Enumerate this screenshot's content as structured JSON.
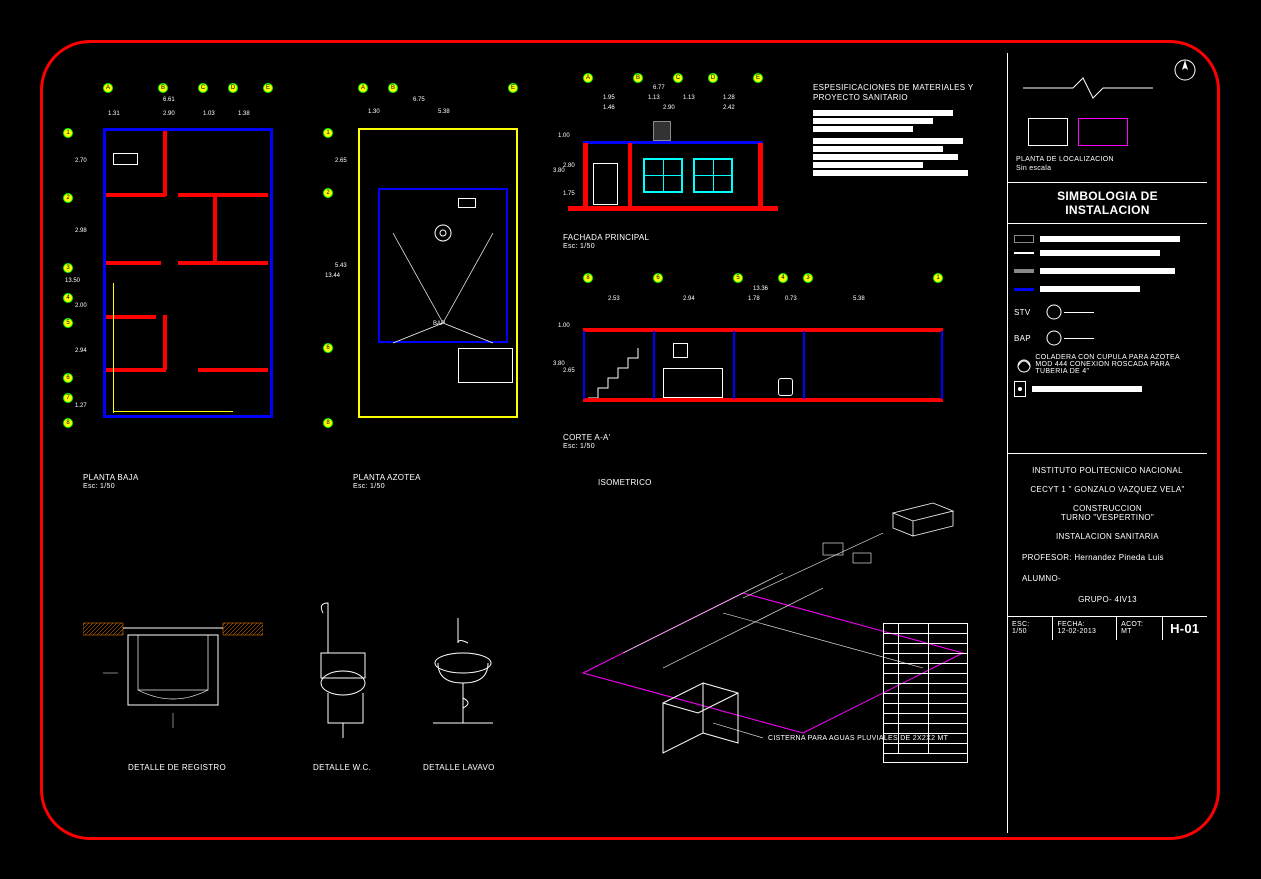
{
  "drawing": {
    "sheet_number": "H-01",
    "scale": "1/50",
    "date": "12-02-2013",
    "units": "MT",
    "scale_label": "ESC:",
    "date_label": "FECHA:",
    "units_label": "ACOT:"
  },
  "title_block": {
    "institution": "INSTITUTO POLITECNICO NACIONAL",
    "school": "CECYT 1 \" GONZALO VAZQUEZ VELA\"",
    "program": "CONSTRUCCION",
    "shift": "TURNO \"VESPERTINO\"",
    "subject": "INSTALACION SANITARIA",
    "professor_label": "PROFESOR:",
    "professor": "Hernandez Pineda Luis",
    "student_label": "ALUMNO-",
    "group_label": "GRUPO-",
    "group": "4IV13"
  },
  "legends": {
    "symbology_title": "SIMBOLOGIA DE INSTALACION",
    "location_plan": "PLANTA DE LOCALIZACION",
    "no_scale": "Sin escala",
    "stv": "STV",
    "bap": "BAP",
    "coladera": "COLADERA CON CUPULA PARA AZOTEA",
    "coladera2": "MOD 444 CONEXION ROSCADA PARA TUBERIA DE 4\"",
    "spec_title": "ESPESIFICACIONES DE MATERIALES Y PROYECTO SANITARIO"
  },
  "views": {
    "planta_baja": {
      "title": "PLANTA BAJA",
      "scale": "Esc: 1/50"
    },
    "planta_azotea": {
      "title": "PLANTA AZOTEA",
      "scale": "Esc: 1/50"
    },
    "fachada": {
      "title": "FACHADA PRINCIPAL",
      "scale": "Esc: 1/50"
    },
    "corte": {
      "title": "CORTE A-A'",
      "scale": "Esc: 1/50"
    },
    "iso": {
      "title": "ISOMETRICO"
    },
    "detalle_registro": {
      "title": "DETALLE DE REGISTRO"
    },
    "detalle_wc": {
      "title": "DETALLE W.C."
    },
    "detalle_lavabo": {
      "title": "DETALLE LAVAVO"
    },
    "cisterna": "CISTERNA PARA AGUAS PLUVIALES DE 2X2X2 MT",
    "bap_label": "BAP"
  },
  "dimensions": {
    "planta_baja": {
      "top_total": "6.61",
      "top": [
        "1.31",
        "2.90",
        "1.03",
        "1.38"
      ],
      "left_total": "13.50",
      "left": [
        "2.70",
        "2.98",
        "2.00",
        "2.94",
        "1.27"
      ],
      "grid_top": [
        "A",
        "B",
        "C",
        "D",
        "E"
      ],
      "grid_left": [
        "1",
        "2",
        "3",
        "4",
        "5",
        "6",
        "7",
        "8"
      ]
    },
    "planta_azotea": {
      "top_total": "6.75",
      "top": [
        "1.30",
        "5.38"
      ],
      "left_total": "13.44",
      "left": [
        "2.65",
        "5.43"
      ],
      "grid_top": [
        "A",
        "B",
        "E"
      ],
      "grid_left": [
        "1",
        "2",
        "6",
        "8"
      ]
    },
    "fachada": {
      "top_total": "6.77",
      "top": [
        "1.95",
        "1.13",
        "1.13",
        "1.28"
      ],
      "top2": [
        "1.46",
        "2.90",
        "2.42"
      ],
      "left_total": "3.80",
      "left": [
        "1.00",
        "2.80",
        "1.75"
      ],
      "grid_top": [
        "A",
        "B",
        "C",
        "D",
        "E"
      ]
    },
    "corte": {
      "top_total": "13.36",
      "top": [
        "2.53",
        "2.94",
        "1.78",
        "0.73",
        "5.38"
      ],
      "left_total": "3.80",
      "left": [
        "1.00",
        "2.65"
      ],
      "grid_top": [
        "8",
        "6",
        "5",
        "4",
        "3",
        "1"
      ]
    }
  }
}
